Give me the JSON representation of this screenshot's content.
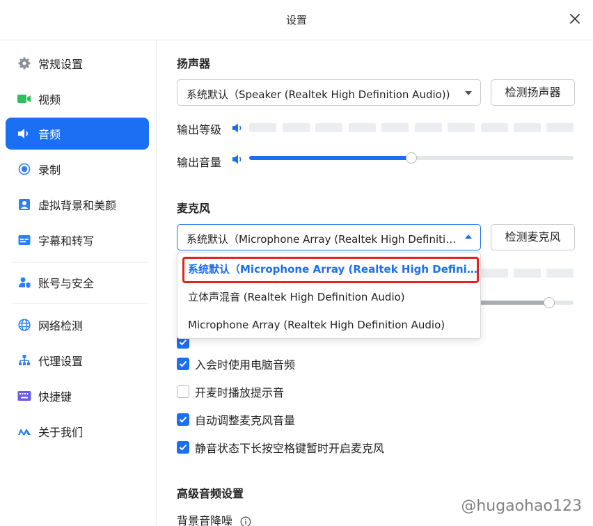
{
  "window": {
    "title": "设置",
    "close_icon": "close-icon"
  },
  "sidebar": {
    "items": [
      {
        "label": "常规设置",
        "icon": "gear-icon",
        "active": false
      },
      {
        "label": "视频",
        "icon": "video-camera-icon",
        "active": false
      },
      {
        "label": "音频",
        "icon": "speaker-icon",
        "active": true
      },
      {
        "label": "录制",
        "icon": "record-icon",
        "active": false
      },
      {
        "label": "虚拟背景和美颜",
        "icon": "portrait-icon",
        "active": false
      },
      {
        "label": "字幕和转写",
        "icon": "caption-icon",
        "active": false
      },
      {
        "label": "账号与安全",
        "icon": "user-shield-icon",
        "active": false
      },
      {
        "label": "网络检测",
        "icon": "globe-icon",
        "active": false
      },
      {
        "label": "代理设置",
        "icon": "network-icon",
        "active": false
      },
      {
        "label": "快捷键",
        "icon": "keyboard-icon",
        "active": false
      },
      {
        "label": "关于我们",
        "icon": "logo-icon",
        "active": false
      }
    ]
  },
  "speaker": {
    "title": "扬声器",
    "selected": "系统默认（Speaker (Realtek High Definition Audio))",
    "test_button": "检测扬声器",
    "output_level_label": "输出等级",
    "output_volume_label": "输出音量",
    "output_volume": 0.5
  },
  "microphone": {
    "title": "麦克风",
    "selected": "系统默认（Microphone Array (Realtek High Definitio...",
    "test_button": "检测麦克风",
    "dropdown_options": [
      "系统默认（Microphone Array (Realtek High Definit...",
      "立体声混音 (Realtek High Definition Audio)",
      "Microphone Array (Realtek High Definition Audio)"
    ],
    "selected_option_index": 0
  },
  "options": [
    {
      "label": "入会时使用电脑音频",
      "checked": true
    },
    {
      "label": "开麦时播放提示音",
      "checked": false
    },
    {
      "label": "自动调整麦克风音量",
      "checked": true
    },
    {
      "label": "静音状态下长按空格键暂时开启麦克风",
      "checked": true
    }
  ],
  "advanced": {
    "title": "高级音频设置",
    "noise_label": "背景音降噪"
  },
  "watermark": "@hugaohao123",
  "colors": {
    "accent": "#1a6ff2",
    "highlight_border": "#e0251b"
  }
}
